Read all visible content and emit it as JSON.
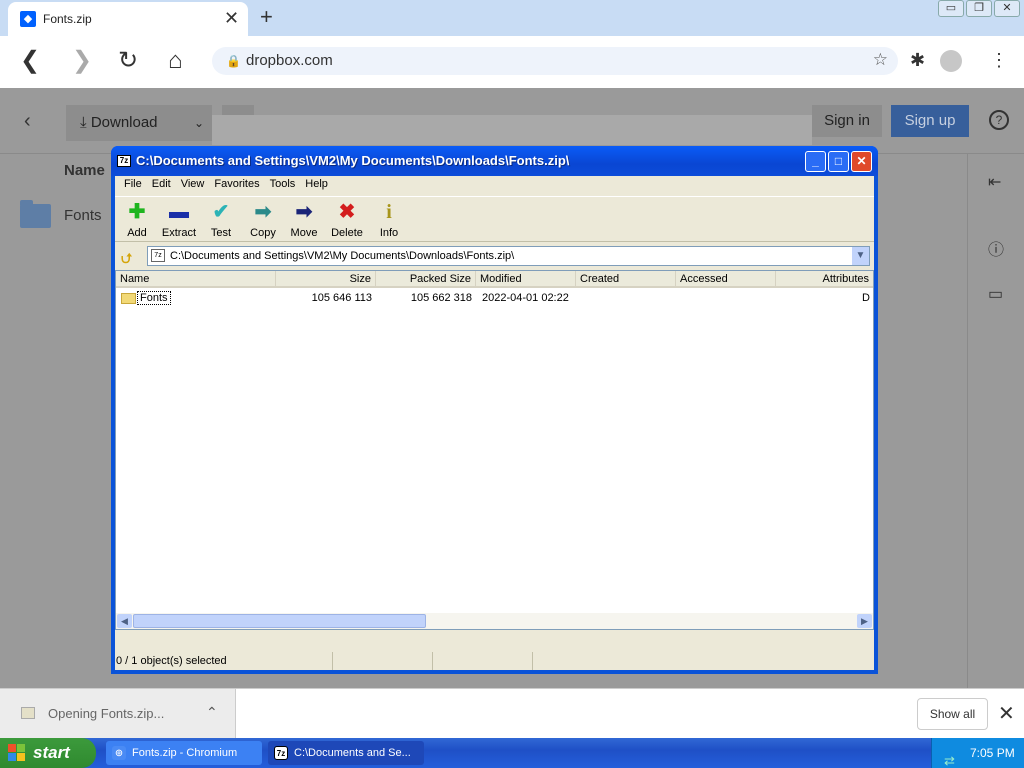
{
  "browser": {
    "tab_title": "Fonts.zip",
    "tab_close": "✕",
    "new_tab": "+",
    "url": "dropbox.com",
    "window_buttons": [
      "▭",
      "❐",
      "✕"
    ]
  },
  "dropbox": {
    "download_label": "Download",
    "signin_label": "Sign in",
    "signup_label": "Sign up",
    "help_label": "?",
    "column_name": "Name",
    "item_name": "Fonts"
  },
  "zip": {
    "title": "C:\\Documents and Settings\\VM2\\My Documents\\Downloads\\Fonts.zip\\",
    "app_icon": "7z",
    "menu": [
      "File",
      "Edit",
      "View",
      "Favorites",
      "Tools",
      "Help"
    ],
    "toolbar": [
      {
        "label": "Add",
        "glyph": "✚",
        "color": "#1fb51f"
      },
      {
        "label": "Extract",
        "glyph": "▬",
        "color": "#1a2fa8"
      },
      {
        "label": "Test",
        "glyph": "✔",
        "color": "#2bb3b6"
      },
      {
        "label": "Copy",
        "glyph": "➡",
        "color": "#2b8a8a"
      },
      {
        "label": "Move",
        "glyph": "➡",
        "color": "#1a2478"
      },
      {
        "label": "Delete",
        "glyph": "✖",
        "color": "#d31d1d"
      },
      {
        "label": "Info",
        "glyph": "i",
        "color": "#a7951a"
      }
    ],
    "address": "C:\\Documents and Settings\\VM2\\My Documents\\Downloads\\Fonts.zip\\",
    "columns": [
      "Name",
      "Size",
      "Packed Size",
      "Modified",
      "Created",
      "Accessed",
      "Attributes"
    ],
    "rows": [
      {
        "name": "Fonts",
        "size": "105 646 113",
        "packed": "105 662 318",
        "modified": "2022-04-01 02:22",
        "created": "",
        "accessed": "",
        "attributes": "D"
      }
    ],
    "status": "0 / 1 object(s) selected"
  },
  "shelf": {
    "item_text": "Opening Fonts.zip...",
    "show_all": "Show all"
  },
  "taskbar": {
    "start_label": "start",
    "tasks": [
      {
        "label": "Fonts.zip - Chromium",
        "icon": "chromium-icon"
      },
      {
        "label": "C:\\Documents and Se...",
        "icon": "7zip-icon"
      }
    ],
    "clock": "7:05 PM"
  },
  "colors": {
    "xp_blue": "#0a53d8",
    "dropbox_blue": "#0061fe",
    "start_green": "#3c9a3c"
  }
}
